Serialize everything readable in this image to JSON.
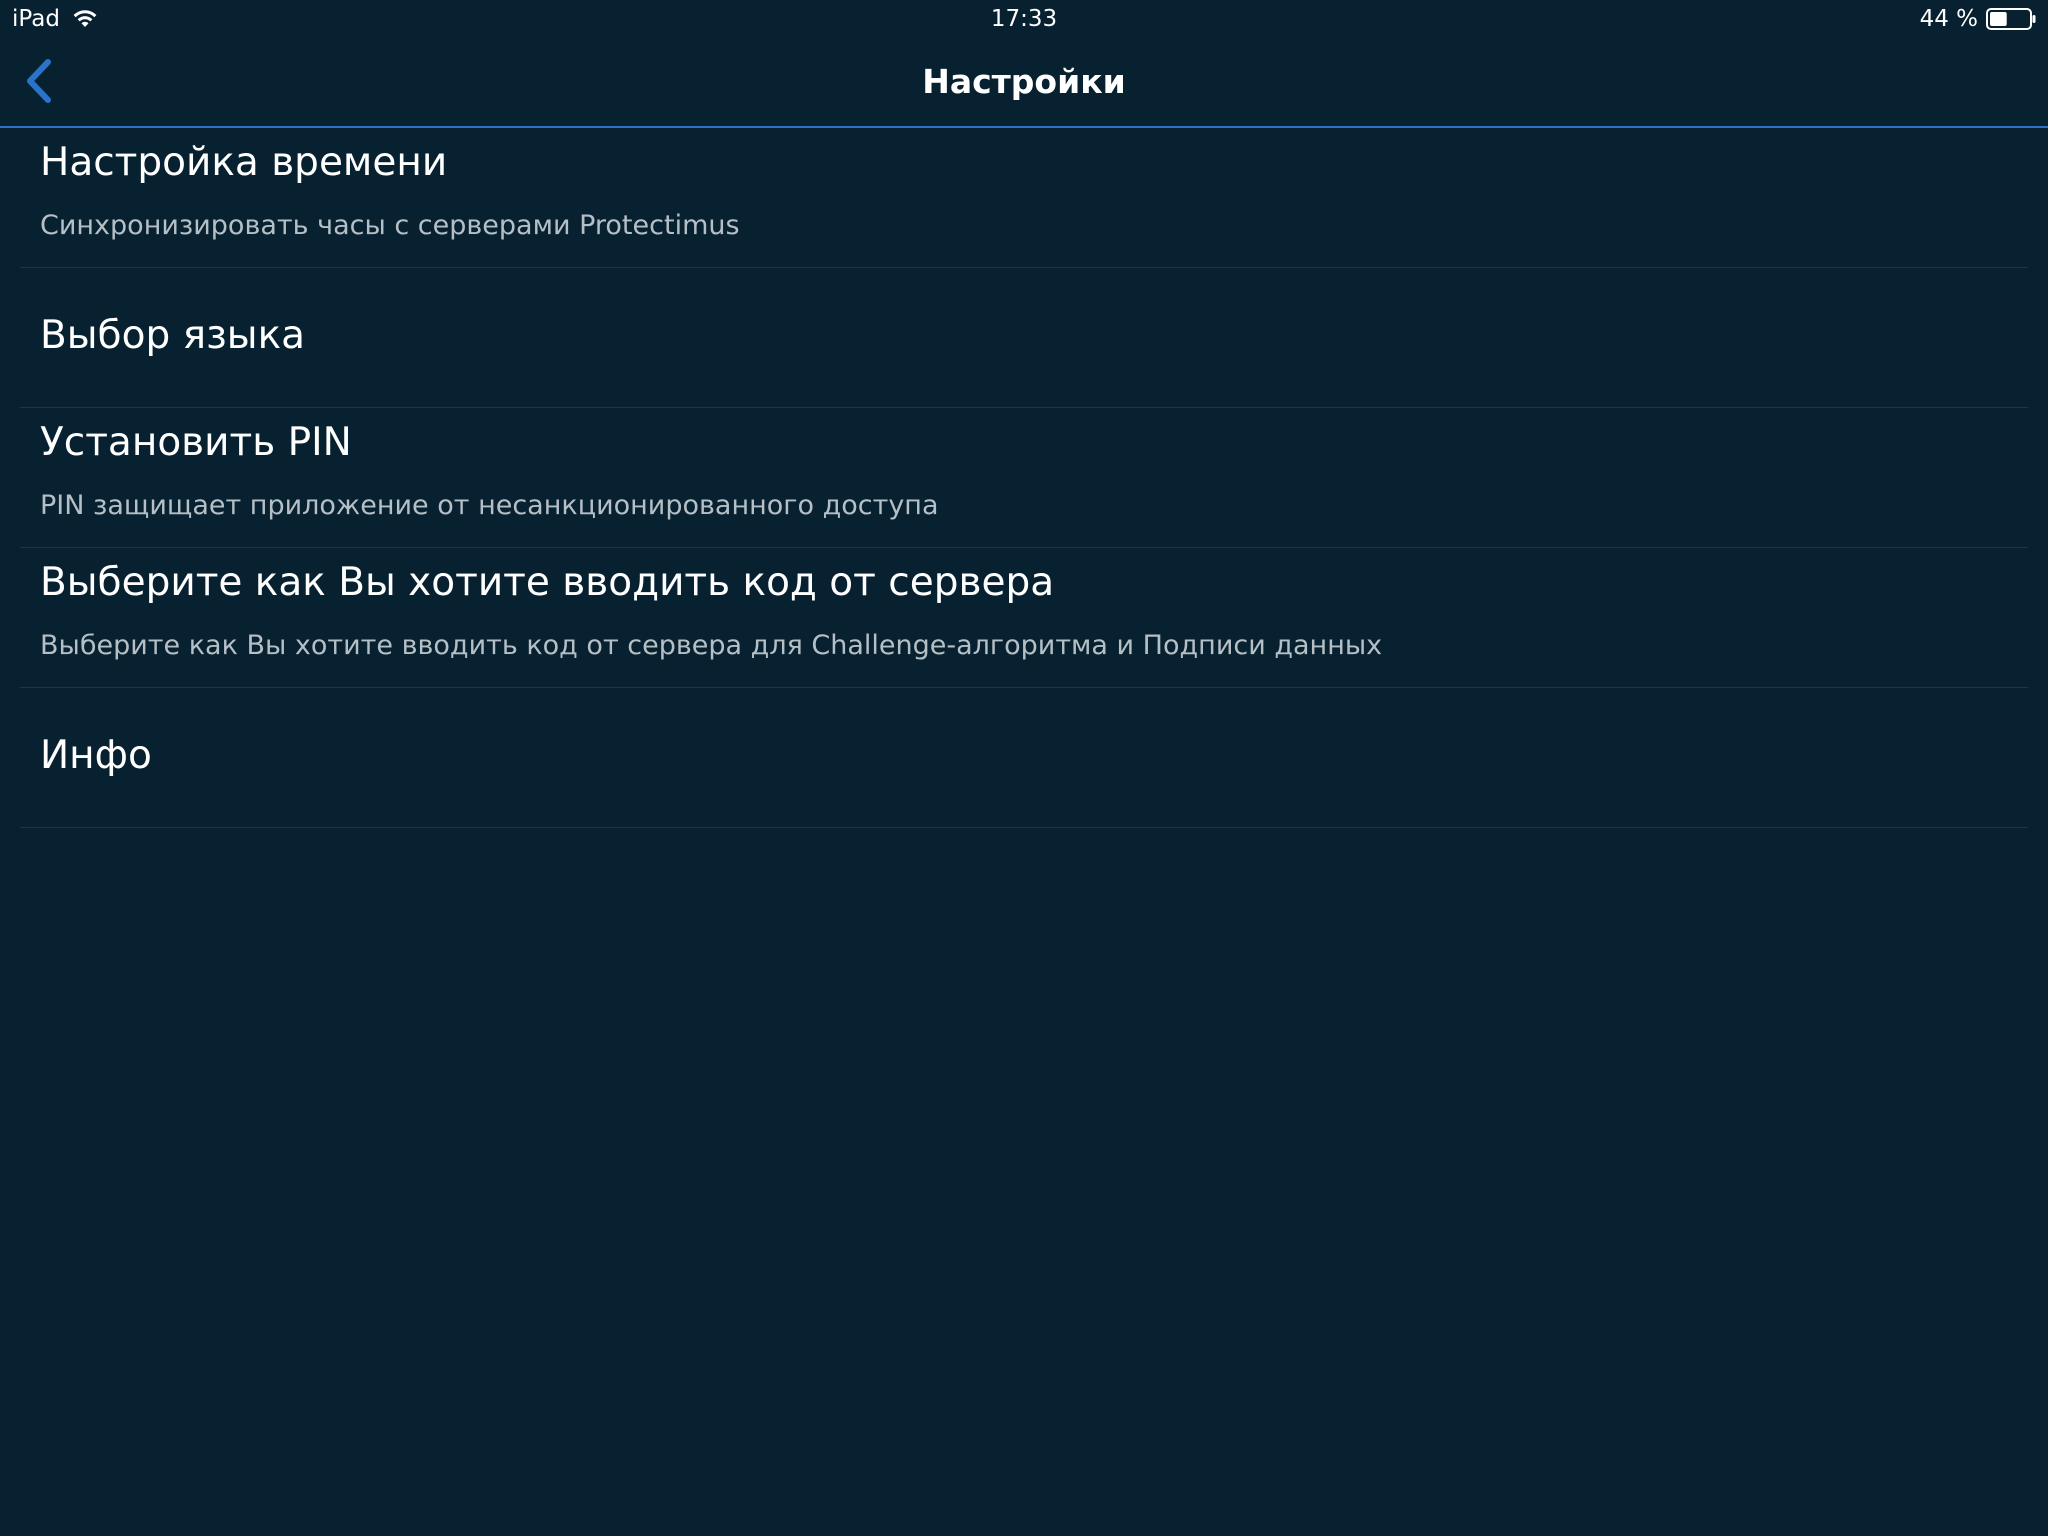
{
  "status_bar": {
    "device": "iPad",
    "time": "17:33",
    "battery": "44 %",
    "battery_level": 0.44,
    "wifi_icon": "wifi-icon",
    "battery_icon": "battery-icon"
  },
  "nav": {
    "title": "Настройки",
    "back_icon": "chevron-left-icon",
    "accent_color": "#2a73c9"
  },
  "settings": {
    "items": [
      {
        "title": "Настройка времени",
        "subtitle": "Синхронизировать часы с серверами Protectimus"
      },
      {
        "title": "Выбор языка"
      },
      {
        "title": "Установить PIN",
        "subtitle": "PIN защищает приложение от несанкционированного доступа"
      },
      {
        "title": "Выберите как Вы хотите вводить код от сервера",
        "subtitle": "Выберите как Вы хотите вводить код от сервера для Challenge-алгоритма и Подписи данных"
      },
      {
        "title": "Инфо"
      }
    ]
  },
  "colors": {
    "background": "#082130",
    "separator": "#1f3644",
    "subtitle": "#b5bfc6"
  }
}
